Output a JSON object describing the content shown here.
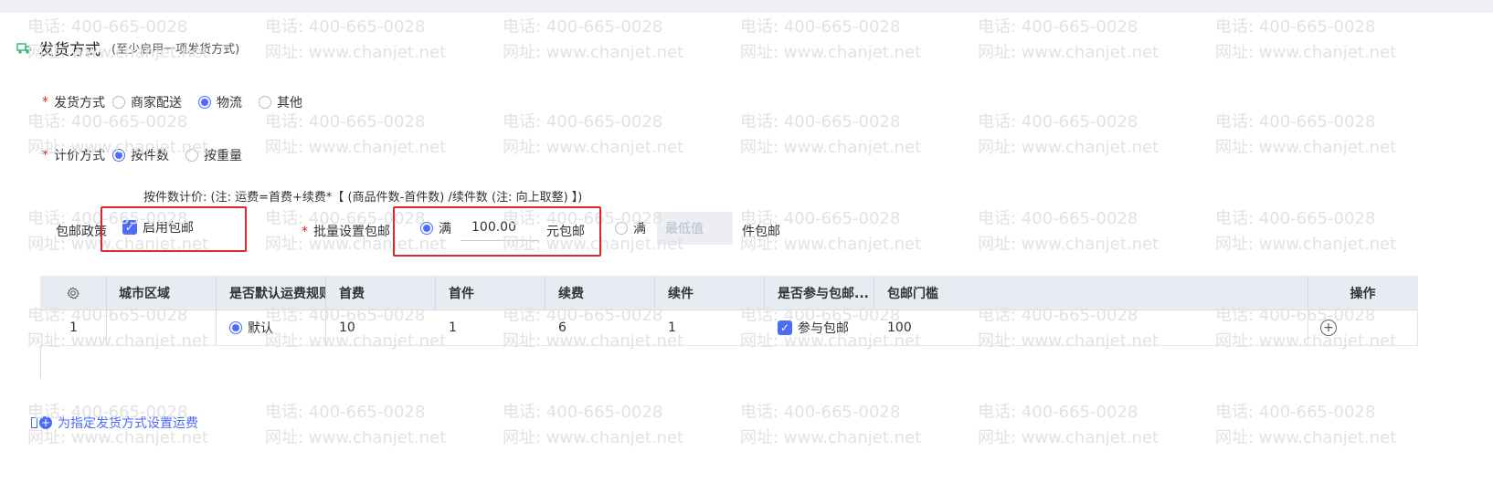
{
  "section": {
    "title": "发货方式",
    "subtitle": "(至少启用一项发货方式)"
  },
  "delivery": {
    "label": "发货方式",
    "required_mark": "*",
    "options": [
      "商家配送",
      "物流",
      "其他"
    ],
    "selected": "物流"
  },
  "pricing": {
    "label": "计价方式",
    "required_mark": "*",
    "options": [
      "按件数",
      "按重量"
    ],
    "selected": "按件数",
    "hint": "按件数计价: (注: 运费=首费+续费*【 (商品件数-首件数) /续件数 (注: 向上取整) 】)"
  },
  "free_shipping": {
    "policy_label": "包邮政策",
    "enable_label": "启用包邮",
    "enabled": true,
    "batch_label": "批量设置包邮",
    "batch_required_mark": "*",
    "opt1_label": "满",
    "opt1_amount": "100.00",
    "opt1_unit": "元包邮",
    "opt1_selected": true,
    "opt2_label": "满",
    "opt2_placeholder": "最低值",
    "opt2_unit": "件包邮",
    "opt2_selected": false
  },
  "table": {
    "headers": [
      "",
      "城市区域",
      "是否默认运费规则",
      "首费",
      "首件",
      "续费",
      "续件",
      "是否参与包邮...",
      "包邮门槛",
      "操作"
    ],
    "rows": [
      {
        "index": "1",
        "region": "",
        "default_label": "默认",
        "first_fee": "10",
        "first_count": "1",
        "extra_fee": "6",
        "extra_count": "1",
        "free_label": "参与包邮",
        "threshold": "100"
      }
    ]
  },
  "add_link": "为指定发货方式设置运费",
  "watermark": {
    "phone": "电话: 400-665-0028",
    "site": "网址: www.chanjet.net"
  },
  "colors": {
    "accent": "#4a6cf7",
    "required": "#e02020",
    "highlight_box": "#e0252b",
    "header_bg": "#e8ebf2"
  },
  "icons": {
    "truck": "truck-icon",
    "gear": "gear-icon",
    "add_row": "plus-circle-icon",
    "add_link": "plus-circle-filled-icon"
  }
}
